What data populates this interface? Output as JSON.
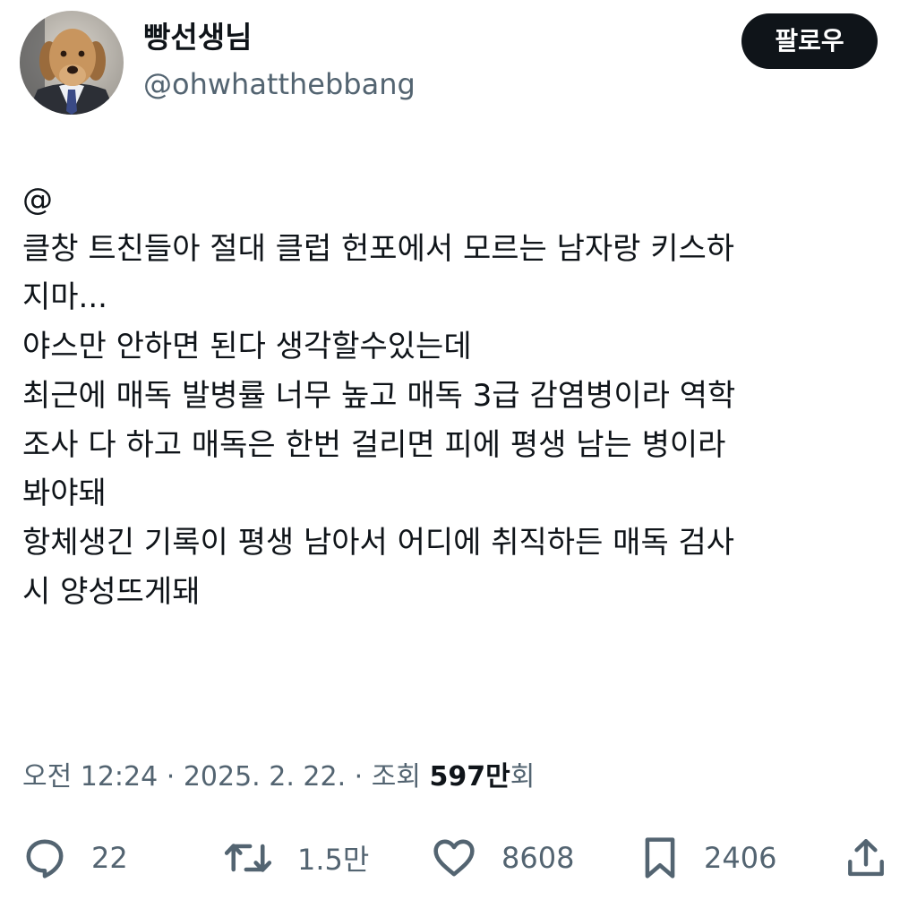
{
  "author": {
    "display_name": "빵선생님",
    "handle": "@ohwhatthebbang",
    "avatar_icon": "dog-in-suit-avatar"
  },
  "follow_button_label": "팔로우",
  "tweet": {
    "lines": [
      "@",
      "클창 트친들아 절대 클럽 헌포에서 모르는 남자랑 키스하",
      "지마...",
      "야스만 안하면 된다 생각할수있는데",
      "최근에 매독 발병률 너무 높고 매독 3급 감염병이라 역학",
      "조사 다 하고 매독은 한번 걸리면 피에 평생 남는 병이라",
      "봐야돼",
      "항체생긴 기록이 평생 남아서 어디에 취직하든 매독 검사",
      "시 양성뜨게돼"
    ]
  },
  "meta": {
    "time": "오전 12:24",
    "separator1": " · ",
    "date": "2025. 2. 22.",
    "separator2": " · ",
    "views_label": "조회 ",
    "views_count": "597만",
    "views_unit": "회"
  },
  "actions": {
    "reply_count": "22",
    "retweet_count": "1.5만",
    "like_count": "8608",
    "bookmark_count": "2406"
  },
  "colors": {
    "text_primary": "#0f1419",
    "text_secondary": "#536471",
    "button_bg": "#0f1419",
    "background": "#ffffff"
  }
}
